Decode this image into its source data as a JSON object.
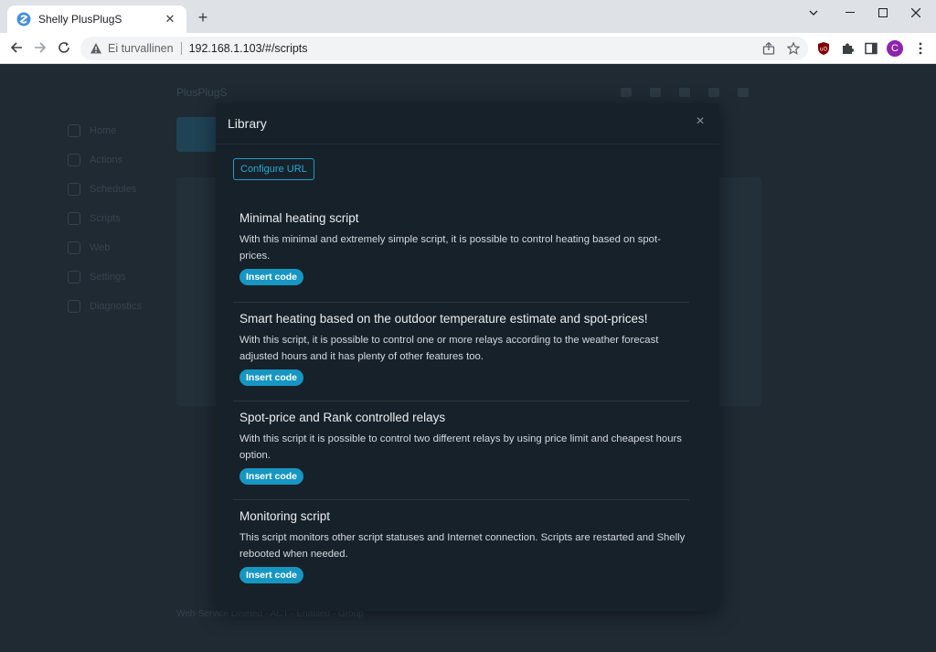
{
  "browser": {
    "tab_title": "Shelly PlusPlugS",
    "tab_close": "✕",
    "new_tab": "+",
    "insecure_label": "Ei turvallinen",
    "url": "192.168.1.103/#/scripts",
    "profile_initial": "C"
  },
  "background_page": {
    "title": "PlusPlugS",
    "sidebar": [
      "Home",
      "Actions",
      "Schedules",
      "Scripts",
      "Web",
      "Settings",
      "Diagnostics"
    ],
    "footer": "Web-Service Deleted  -  ACT  -  Enabled  -  Group"
  },
  "modal": {
    "title": "Library",
    "close_symbol": "×",
    "configure_url_label": "Configure URL",
    "entries": [
      {
        "title": "Minimal heating script",
        "description": "With this minimal and extremely simple script, it is possible to control heating based on spot-prices.",
        "button": "Insert code"
      },
      {
        "title": "Smart heating based on the outdoor temperature estimate and spot-prices!",
        "description": "With this script, it is possible to control one or more relays according to the weather forecast adjusted hours and it has plenty of other features too.",
        "button": "Insert code"
      },
      {
        "title": "Spot-price and Rank controlled relays",
        "description": "With this script it is possible to control two different relays by using price limit and cheapest hours option.",
        "button": "Insert code"
      },
      {
        "title": "Monitoring script",
        "description": "This script monitors other script statuses and Internet connection. Scripts are restarted and Shelly rebooted when needed.",
        "button": "Insert code"
      }
    ]
  },
  "colors": {
    "accent": "#1796c2",
    "modal_bg": "#17212a",
    "page_bg": "#1f2a33"
  }
}
